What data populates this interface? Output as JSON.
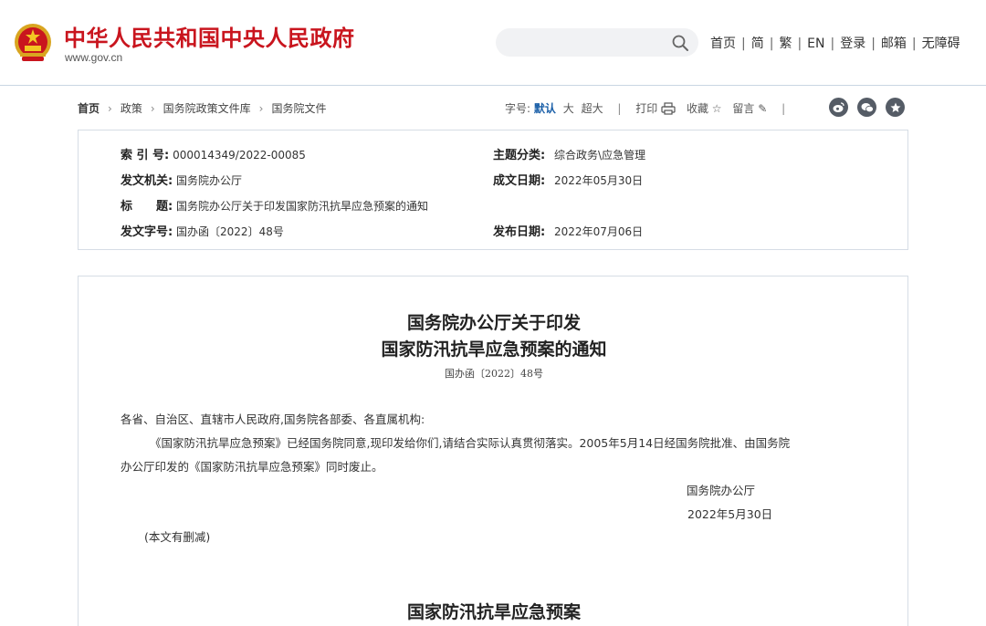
{
  "header": {
    "site_title": "中华人民共和国中央人民政府",
    "site_url": "www.gov.cn",
    "search": {
      "placeholder": "",
      "icon": "search-icon"
    },
    "nav": [
      "首页",
      "简",
      "繁",
      "EN",
      "登录",
      "邮箱",
      "无障碍"
    ]
  },
  "breadcrumb": [
    "首页",
    "政策",
    "国务院政策文件库",
    "国务院文件"
  ],
  "tools": {
    "font_label": "字号:",
    "font_default": "默认",
    "font_large": "大",
    "font_xlarge": "超大",
    "print": "打印",
    "favorite": "收藏",
    "comment": "留言"
  },
  "share_icons": [
    "weibo-icon",
    "wechat-icon",
    "favorite-star-icon"
  ],
  "meta": {
    "index_label": "索 引 号:",
    "index_value": "000014349/2022-00085",
    "category_label": "主题分类:",
    "category_value": "综合政务\\应急管理",
    "issuer_label": "发文机关:",
    "issuer_value": "国务院办公厅",
    "written_label": "成文日期:",
    "written_value": "2022年05月30日",
    "title_label": "标　　题:",
    "title_value": "国务院办公厅关于印发国家防汛抗旱应急预案的通知",
    "docno_label": "发文字号:",
    "docno_value": "国办函〔2022〕48号",
    "published_label": "发布日期:",
    "published_value": "2022年07月06日"
  },
  "article": {
    "title_line1": "国务院办公厅关于印发",
    "title_line2": "国家防汛抗旱应急预案的通知",
    "doc_number": "国办函〔2022〕48号",
    "salutation": "各省、自治区、直辖市人民政府,国务院各部委、各直属机构:",
    "body_line1": "《国家防汛抗旱应急预案》已经国务院同意,现印发给你们,请结合实际认真贯彻落实。2005年5月14日经国务院批准、由国务院",
    "body_line2": "办公厅印发的《国家防汛抗旱应急预案》同时废止。",
    "signature": "国务院办公厅",
    "date": "2022年5月30日",
    "note": "(本文有删减)",
    "section_title": "国家防汛抗旱应急预案"
  },
  "colors": {
    "brand_red": "#c9151e",
    "accent_blue": "#1a5fa8",
    "icon_gray": "#555c66"
  }
}
